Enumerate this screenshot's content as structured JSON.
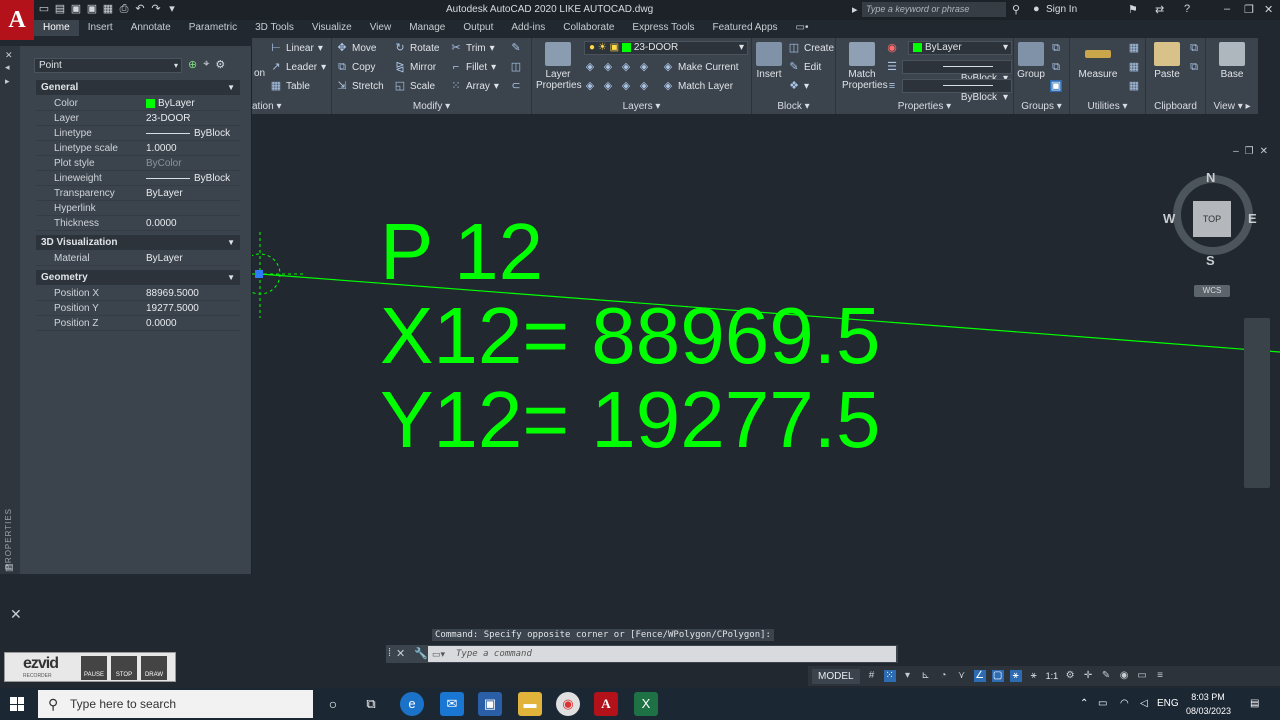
{
  "window": {
    "title": "Autodesk AutoCAD 2020    LIKE AUTOCAD.dwg",
    "search_placeholder": "Type a keyword or phrase",
    "sign_in": "Sign In",
    "app_letter": "A"
  },
  "ribbon_tabs": [
    "Home",
    "Insert",
    "Annotate",
    "Parametric",
    "3D Tools",
    "Visualize",
    "View",
    "Manage",
    "Output",
    "Add-ins",
    "Collaborate",
    "Express Tools",
    "Featured Apps"
  ],
  "ribbon": {
    "annotation": {
      "linear": "Linear",
      "leader": "Leader",
      "table": "Table",
      "label_partial": "ation",
      "on_partial": "on"
    },
    "modify": {
      "move": "Move",
      "rotate": "Rotate",
      "trim": "Trim",
      "copy": "Copy",
      "mirror": "Mirror",
      "fillet": "Fillet",
      "stretch": "Stretch",
      "scale": "Scale",
      "array": "Array",
      "label": "Modify"
    },
    "layers": {
      "layer_properties": "Layer Properties",
      "current_layer": "23-DOOR",
      "make_current": "Make Current",
      "match_layer": "Match Layer",
      "label": "Layers"
    },
    "block": {
      "insert": "Insert",
      "create": "Create",
      "edit": "Edit",
      "label": "Block"
    },
    "properties": {
      "match_properties": "Match Properties",
      "color": "ByLayer",
      "linetype": "ByBlock",
      "lineweight": "ByBlock",
      "label": "Properties"
    },
    "groups": {
      "group": "Group",
      "label": "Groups"
    },
    "utilities": {
      "measure": "Measure",
      "label": "Utilities"
    },
    "clipboard": {
      "paste": "Paste",
      "label": "Clipboard"
    },
    "view": {
      "base": "Base",
      "label": "View"
    }
  },
  "properties_palette": {
    "object_type": "Point",
    "strip_label": "PROPERTIES",
    "general": {
      "title": "General",
      "rows": [
        {
          "key": "Color",
          "value": "ByLayer"
        },
        {
          "key": "Layer",
          "value": "23-DOOR"
        },
        {
          "key": "Linetype",
          "value": "ByBlock"
        },
        {
          "key": "Linetype scale",
          "value": "1.0000"
        },
        {
          "key": "Plot style",
          "value": "ByColor"
        },
        {
          "key": "Lineweight",
          "value": "ByBlock"
        },
        {
          "key": "Transparency",
          "value": "ByLayer"
        },
        {
          "key": "Hyperlink",
          "value": ""
        },
        {
          "key": "Thickness",
          "value": "0.0000"
        }
      ]
    },
    "visualization": {
      "title": "3D Visualization",
      "rows": [
        {
          "key": "Material",
          "value": "ByLayer"
        }
      ]
    },
    "geometry": {
      "title": "Geometry",
      "rows": [
        {
          "key": "Position X",
          "value": "88969.5000"
        },
        {
          "key": "Position Y",
          "value": "19277.5000"
        },
        {
          "key": "Position Z",
          "value": "0.0000"
        }
      ]
    }
  },
  "canvas": {
    "line1": "P 12",
    "line2": "X12= 88969.5",
    "line3": "Y12= 19277.5",
    "text_color": "#00ff00"
  },
  "viewcube": {
    "n": "N",
    "s": "S",
    "e": "E",
    "w": "W",
    "face": "TOP",
    "wcs": "WCS"
  },
  "command": {
    "history": "Command: Specify opposite corner or [Fence/WPolygon/CPolygon]:",
    "placeholder": "Type a command"
  },
  "recorder": {
    "logo": "ezvid",
    "sub": "RECORDER",
    "pause": "PAUSE",
    "stop": "STOP",
    "draw": "DRAW"
  },
  "statusbar": {
    "model": "MODEL",
    "scale": "1:1"
  },
  "taskbar": {
    "search_placeholder": "Type here to search",
    "lang": "ENG",
    "time": "8:03 PM",
    "date": "08/03/2023"
  }
}
